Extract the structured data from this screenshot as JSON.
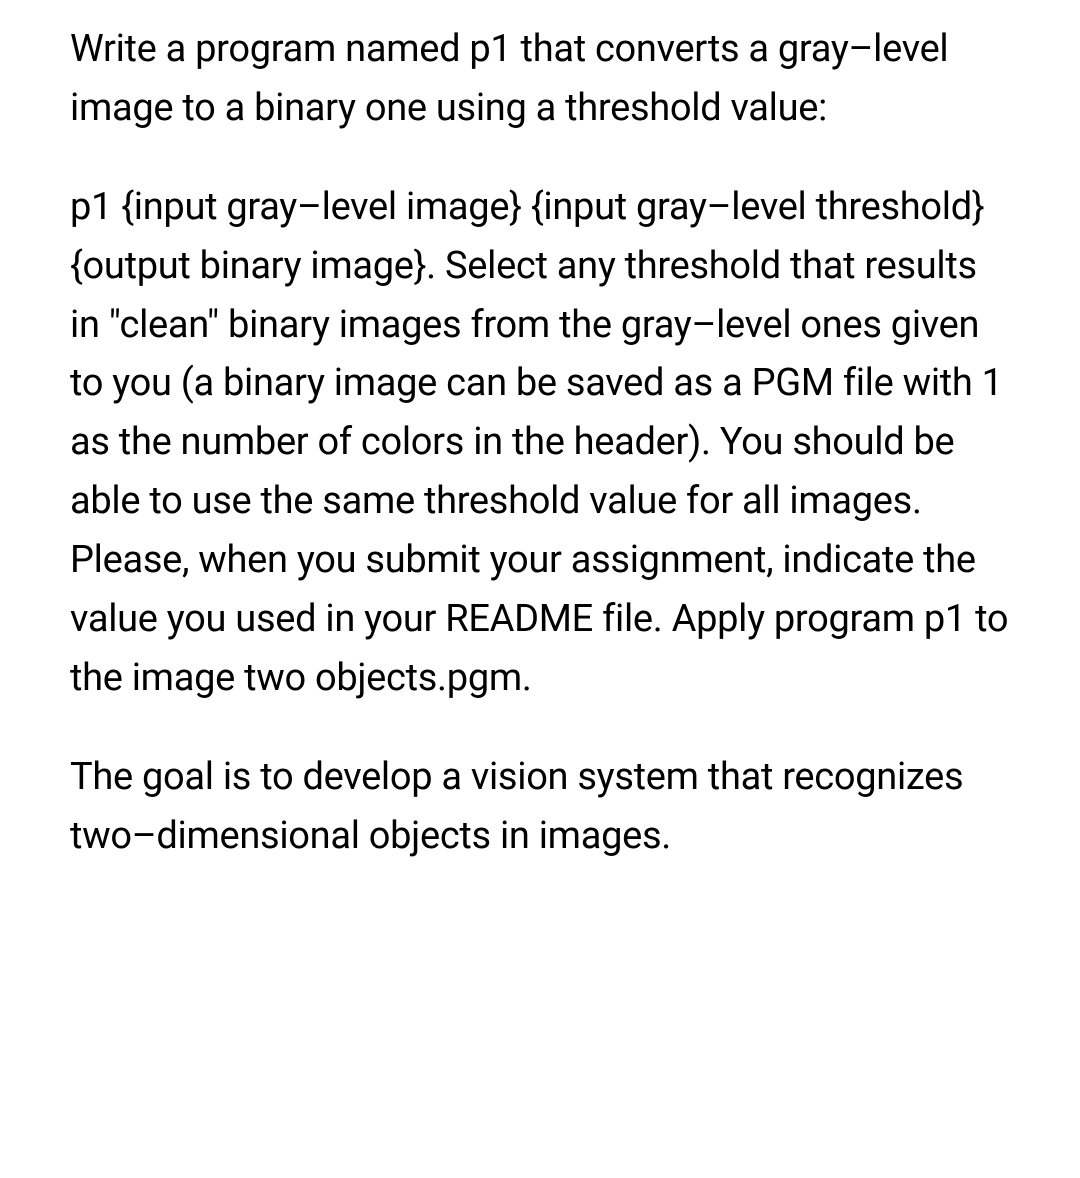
{
  "paragraphs": [
    "Write a program named p1 that converts a gray–level image to a binary one using a threshold value:",
    "p1 {input gray–level image} {input gray–level threshold} {output binary image}. Select any threshold that results in \"clean\" binary images from the gray–level ones given to you (a binary image can be saved as a PGM file with 1 as the number of colors in the header). You should be able to use the same threshold value for all images. Please, when you submit your assignment, indicate the value you used in your README file. Apply program p1 to the image two objects.pgm.",
    "The goal is to develop a vision system that recognizes two–dimensional objects in images."
  ]
}
